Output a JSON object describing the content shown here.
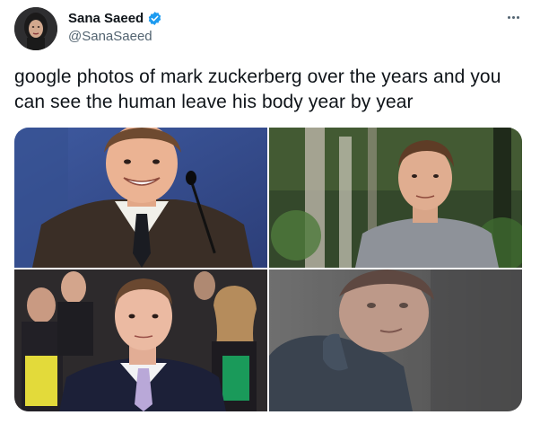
{
  "author": {
    "display_name": "Sana Saeed",
    "handle": "@SanaSaeed",
    "verified": true
  },
  "tweet": {
    "text": "google photos of mark zuckerberg over the years and you can see the human leave his body year by year"
  },
  "media": {
    "count": 4
  },
  "icons": {
    "more": "more-options-icon",
    "verified": "verified-badge-icon"
  },
  "colors": {
    "verified_blue": "#1d9bf0",
    "text_primary": "#0f1419",
    "text_secondary": "#536471"
  }
}
